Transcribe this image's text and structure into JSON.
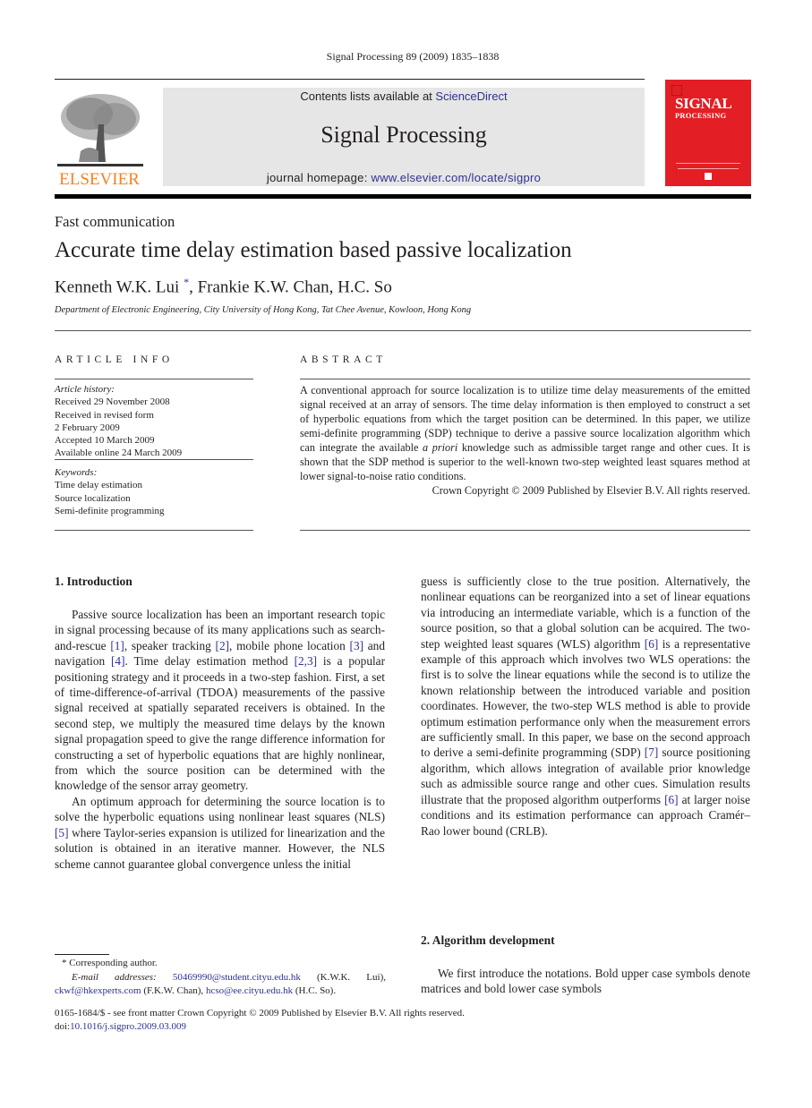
{
  "header": {
    "running_head": "Signal Processing 89 (2009) 1835–1838",
    "contents_prefix": "Contents lists available at ",
    "contents_link": "ScienceDirect",
    "journal_title": "Signal Processing",
    "homepage_prefix": "journal homepage: ",
    "homepage_link": "www.elsevier.com/locate/sigpro",
    "publisher_logo_text": "ELSEVIER",
    "cover_title_line1": "SIGNAL",
    "cover_title_line2": "PROCESSING"
  },
  "article": {
    "type": "Fast communication",
    "title": "Accurate time delay estimation based passive localization",
    "author1": "Kenneth W.K. Lui",
    "author1_mark": "*",
    "authors_rest": ", Frankie K.W. Chan, H.C. So",
    "affiliation": "Department of Electronic Engineering, City University of Hong Kong, Tat Chee Avenue, Kowloon, Hong Kong"
  },
  "article_info": {
    "heading": "ARTICLE INFO",
    "history_label": "Article history:",
    "history": [
      "Received 29 November 2008",
      "Received in revised form",
      "2 February 2009",
      "Accepted 10 March 2009",
      "Available online 24 March 2009"
    ],
    "keywords_label": "Keywords:",
    "keywords": [
      "Time delay estimation",
      "Source localization",
      "Semi-definite programming"
    ]
  },
  "abstract": {
    "heading": "ABSTRACT",
    "text_part1": "A conventional approach for source localization is to utilize time delay measurements of the emitted signal received at an array of sensors. The time delay information is then employed to construct a set of hyperbolic equations from which the target position can be determined. In this paper, we utilize semi-definite programming (SDP) technique to derive a passive source localization algorithm which can integrate the available ",
    "text_italic": "a priori",
    "text_part2": " knowledge such as admissible target range and other cues. It is shown that the SDP method is superior to the well-known two-step weighted least squares method at lower signal-to-noise ratio conditions.",
    "copyright": "Crown Copyright © 2009 Published by Elsevier B.V. All rights reserved."
  },
  "sections": {
    "intro_heading": "1.  Introduction",
    "intro_p1": [
      "Passive source localization has been an important research topic in signal processing because of its many applications such as search-and-rescue ",
      "[1]",
      ", speaker tracking ",
      "[2]",
      ", mobile phone location ",
      "[3]",
      " and navigation ",
      "[4]",
      ". Time delay estimation method ",
      "[2,3]",
      " is a popular positioning strategy and it proceeds in a two-step fashion. First, a set of time-difference-of-arrival (TDOA) measurements of the passive signal received at spatially separated receivers is obtained. In the second step, we multiply the measured time delays by the known signal propagation speed to give the range difference information for constructing a set of hyperbolic equations that are highly nonlinear, from which the source position can be determined with the knowledge of the sensor array geometry."
    ],
    "intro_p2": [
      "An optimum approach for determining the source location is to solve the hyperbolic equations using nonlinear least squares (NLS) ",
      "[5]",
      " where Taylor-series expansion is utilized for linearization and the solution is obtained in an iterative manner. However, the NLS scheme cannot guarantee global convergence unless the initial "
    ],
    "intro_p2_cont": [
      "guess is sufficiently close to the true position. Alternatively, the nonlinear equations can be reorganized into a set of linear equations via introducing an intermediate variable, which is a function of the source position, so that a global solution can be acquired. The two-step weighted least squares (WLS) algorithm ",
      "[6]",
      " is a representative example of this approach which involves two WLS operations: the first is to solve the linear equations while the second is to utilize the known relationship between the introduced variable and position coordinates. However, the two-step WLS method is able to provide optimum estimation performance only when the measurement errors are sufficiently small. In this paper, we base on the second approach to derive a semi-definite programming (SDP) ",
      "[7]",
      " source positioning algorithm, which allows integration of available prior knowledge such as admissible source range and other cues. Simulation results illustrate that the proposed algorithm outperforms ",
      "[6]",
      " at larger noise conditions and its estimation performance can approach Cramér–Rao lower bound (CRLB)."
    ],
    "algo_heading": "2.  Algorithm development",
    "algo_p1": "We first introduce the notations. Bold upper case symbols denote matrices and bold lower case symbols"
  },
  "footnotes": {
    "corresponding": "* Corresponding author.",
    "email_label": "E-mail addresses:",
    "email1": "50469990@student.cityu.edu.hk",
    "email1_owner": " (K.W.K. Lui),",
    "email2": "ckwf@hkexperts.com",
    "email2_owner": " (F.K.W. Chan), ",
    "email3": "hcso@ee.cityu.edu.hk",
    "email3_owner": " (H.C. So).",
    "issn_line": "0165-1684/$ - see front matter Crown Copyright © 2009 Published by Elsevier B.V. All rights reserved.",
    "doi_prefix": "doi:",
    "doi_link": "10.1016/j.sigpro.2009.03.009"
  },
  "colors": {
    "link": "#2e3192",
    "cover_red": "#e31e24",
    "elsevier_orange": "#f58220",
    "banner_gray": "#e6e6e6"
  }
}
